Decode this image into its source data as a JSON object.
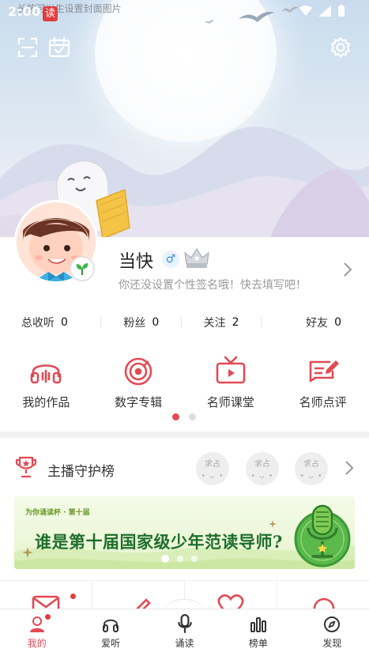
{
  "status_bar": {
    "time": "2:00",
    "read_badge": "读",
    "cover_hint": "· 长按可以生设置封面图片"
  },
  "header": {
    "scan_icon": "scan-icon",
    "calendar_icon": "calendar-check-icon",
    "settings_icon": "gear-icon"
  },
  "profile": {
    "nickname": "当快",
    "gender_symbol": "♂",
    "signature": "你还没设置个性签名哦！快去填写吧！"
  },
  "stats": [
    {
      "label": "总收听",
      "value": "0"
    },
    {
      "label": "粉丝",
      "value": "0"
    },
    {
      "label": "关注",
      "value": "2"
    },
    {
      "label": "好友",
      "value": "0"
    }
  ],
  "features": [
    {
      "label": "我的作品",
      "icon": "headphones-icon"
    },
    {
      "label": "数字专辑",
      "icon": "vinyl-disc-icon"
    },
    {
      "label": "名师课堂",
      "icon": "tv-icon"
    },
    {
      "label": "名师点评",
      "icon": "comment-edit-icon"
    }
  ],
  "guardians": {
    "title": "主播守护榜",
    "seek_slots": [
      {
        "label": "求占",
        "face": "• ᴗ •"
      },
      {
        "label": "求占",
        "face": "• ᴗ •"
      },
      {
        "label": "求占",
        "face": "• ᴗ •"
      }
    ]
  },
  "banner": {
    "subtitle": "为你诵读杯 · 第十届",
    "title": "谁是第十届国家级少年范读导师?"
  },
  "bottom_nav": [
    {
      "label": "我的",
      "icon": "person-icon",
      "active": true
    },
    {
      "label": "爱听",
      "icon": "headphones-icon",
      "active": false
    },
    {
      "label": "诵读",
      "icon": "microphone-icon",
      "active": false
    },
    {
      "label": "榜单",
      "icon": "bar-chart-icon",
      "active": false
    },
    {
      "label": "发现",
      "icon": "compass-icon",
      "active": false
    }
  ],
  "colors": {
    "accent": "#e24a55",
    "banner_green": "#1f6e2c"
  }
}
